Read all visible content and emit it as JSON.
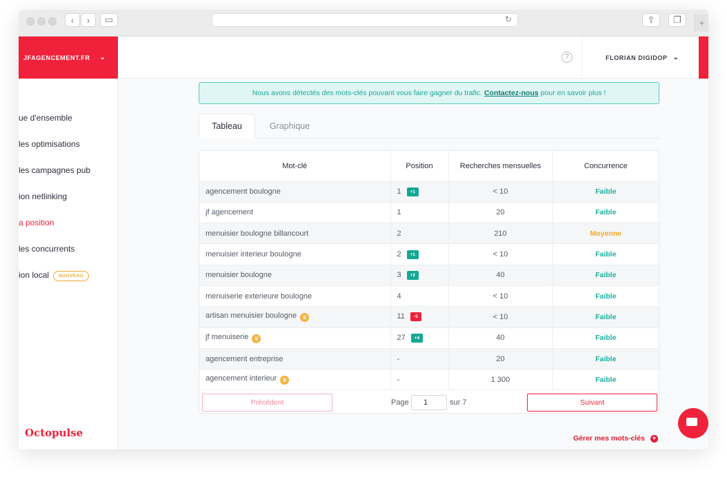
{
  "browser": {
    "back_icon": "chevron-left-icon",
    "forward_icon": "chevron-right-icon",
    "sidebar_icon": "sidebar-icon",
    "reload_icon": "reload-icon",
    "share_icon": "share-icon",
    "tabs_icon": "tabs-icon",
    "new_tab_icon": "plus-icon"
  },
  "brand": {
    "account_name": "JFAGENCEMENT.FR",
    "logo": "Octopulse"
  },
  "header": {
    "help_icon": "question-circle-icon",
    "user_name": "FLORIAN DIGIDOP"
  },
  "sidebar": {
    "items": [
      {
        "label": "ue d'ensemble",
        "active": false
      },
      {
        "label": "les optimisations",
        "active": false
      },
      {
        "label": "les campagnes pub",
        "active": false
      },
      {
        "label": "ion netlinking",
        "active": false
      },
      {
        "label": "a position",
        "active": true
      },
      {
        "label": "les concurrents",
        "active": false
      },
      {
        "label": "ion local",
        "active": false,
        "badge": "NOUVEAU"
      }
    ]
  },
  "banner": {
    "text_before": "Nous avons détectés des mots-clés pouvant vous faire gagner du trafic.",
    "link_text": "Contactez-nous",
    "text_after": "pour en savoir plus !"
  },
  "tabs": [
    {
      "label": "Tableau",
      "active": true
    },
    {
      "label": "Graphique",
      "active": false
    }
  ],
  "table": {
    "headers": [
      "Mot-clé",
      "Position",
      "Recherches mensuelles",
      "Concurrence"
    ],
    "rows": [
      {
        "keyword": "agencement boulogne",
        "star": false,
        "position": "1",
        "change": "+1",
        "change_type": "up",
        "volume": "< 10",
        "competition": "Faible"
      },
      {
        "keyword": "jf agencement",
        "star": false,
        "position": "1",
        "change": "",
        "change_type": "",
        "volume": "20",
        "competition": "Faible"
      },
      {
        "keyword": "menuisier boulogne billancourt",
        "star": false,
        "position": "2",
        "change": "",
        "change_type": "",
        "volume": "210",
        "competition": "Moyenne"
      },
      {
        "keyword": "menuisier interieur boulogne",
        "star": false,
        "position": "2",
        "change": "+1",
        "change_type": "up",
        "volume": "< 10",
        "competition": "Faible"
      },
      {
        "keyword": "menuisier boulogne",
        "star": false,
        "position": "3",
        "change": "+2",
        "change_type": "up",
        "volume": "40",
        "competition": "Faible"
      },
      {
        "keyword": "menuiserie exterieure boulogne",
        "star": false,
        "position": "4",
        "change": "",
        "change_type": "",
        "volume": "< 10",
        "competition": "Faible"
      },
      {
        "keyword": "artisan menuisier boulogne",
        "star": true,
        "position": "11",
        "change": "-5",
        "change_type": "down",
        "volume": "< 10",
        "competition": "Faible"
      },
      {
        "keyword": "jf menuiserie",
        "star": true,
        "position": "27",
        "change": "+4",
        "change_type": "up",
        "volume": "40",
        "competition": "Faible"
      },
      {
        "keyword": "agencement entreprise",
        "star": false,
        "position": "-",
        "change": "",
        "change_type": "",
        "volume": "20",
        "competition": "Faible"
      },
      {
        "keyword": "agencement interieur",
        "star": true,
        "position": "-",
        "change": "",
        "change_type": "",
        "volume": "1 300",
        "competition": "Faible"
      }
    ]
  },
  "pagination": {
    "prev_label": "Précédent",
    "page_label": "Page",
    "page_value": "1",
    "total_label": "sur 7",
    "next_label": "Suivant"
  },
  "footer": {
    "manage_label": "Gérer mes mots-clés",
    "manage_icon": "plus-circle-icon"
  },
  "colors": {
    "brand_red": "#f0213b",
    "teal": "#14a895",
    "low": "#1bb29f",
    "medium": "#f5a623",
    "down": "#f0213b"
  }
}
